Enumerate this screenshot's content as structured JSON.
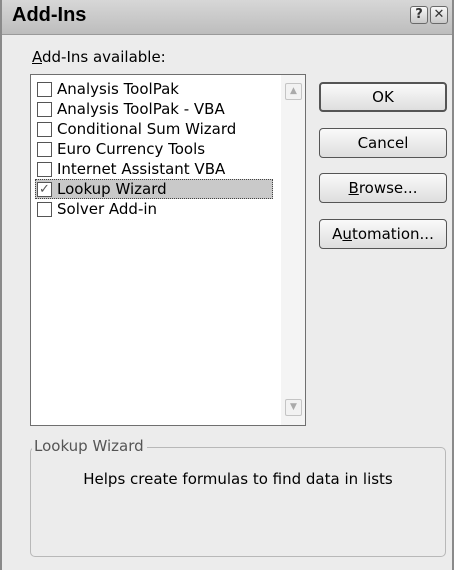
{
  "window": {
    "title": "Add-Ins",
    "help_glyph": "?",
    "close_glyph": "✕"
  },
  "list": {
    "label_accesskey": "A",
    "label_rest": "dd-Ins available:",
    "items": [
      {
        "label": "Analysis ToolPak",
        "checked": false
      },
      {
        "label": "Analysis ToolPak - VBA",
        "checked": false
      },
      {
        "label": "Conditional Sum Wizard",
        "checked": false
      },
      {
        "label": "Euro Currency Tools",
        "checked": false
      },
      {
        "label": "Internet Assistant VBA",
        "checked": false
      },
      {
        "label": "Lookup Wizard",
        "checked": true,
        "selected": true
      },
      {
        "label": "Solver Add-in",
        "checked": false
      }
    ],
    "check_glyph": "✓"
  },
  "buttons": {
    "ok": "OK",
    "cancel": "Cancel",
    "browse_accesskey": "B",
    "browse_rest": "rowse...",
    "automation_pre": "A",
    "automation_accesskey": "u",
    "automation_rest": "tomation..."
  },
  "description": {
    "heading": "Lookup Wizard",
    "text": "Helps create formulas to find data in lists"
  },
  "icons": {
    "scroll_up": "▲",
    "scroll_down": "▼"
  }
}
